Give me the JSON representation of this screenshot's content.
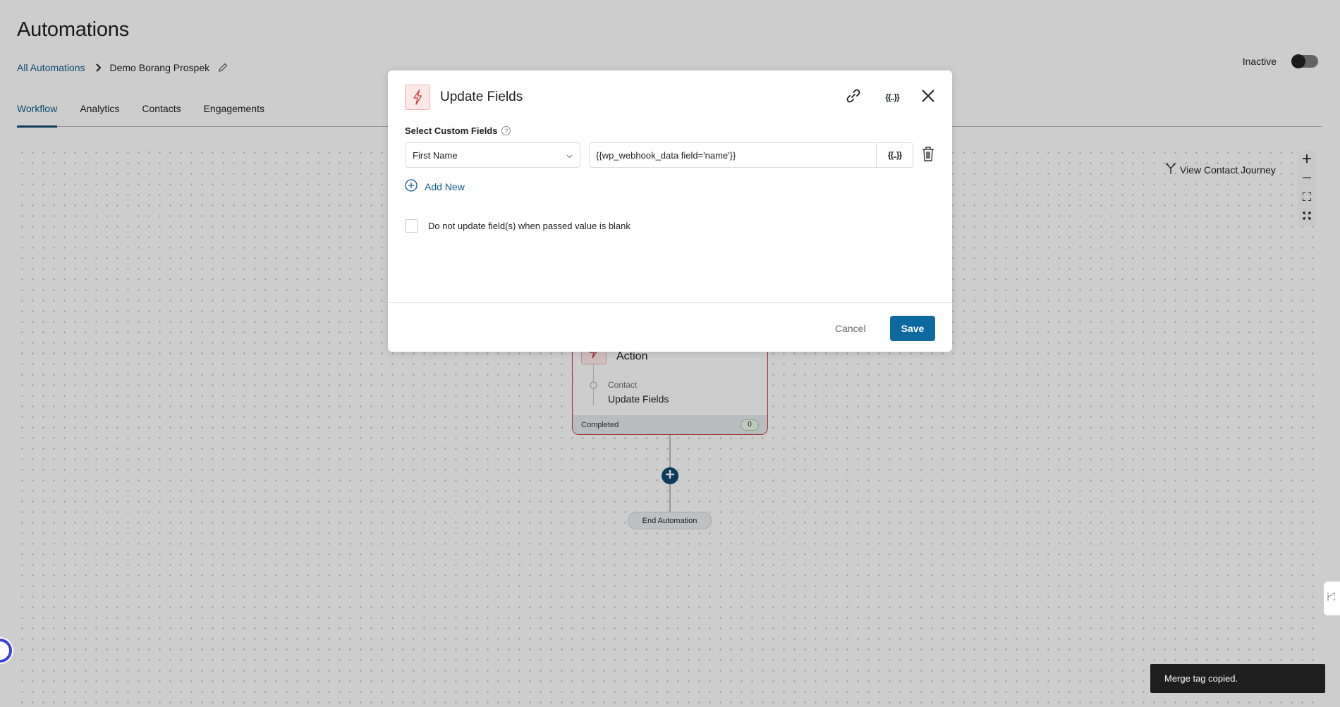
{
  "page": {
    "title": "Automations",
    "breadcrumb": {
      "root": "All Automations",
      "current": "Demo Borang Prospek"
    },
    "tabs": [
      {
        "label": "Workflow",
        "active": true
      },
      {
        "label": "Analytics",
        "active": false
      },
      {
        "label": "Contacts",
        "active": false
      },
      {
        "label": "Engagements",
        "active": false
      }
    ],
    "status": {
      "label": "Inactive",
      "enabled": false
    }
  },
  "canvas": {
    "journey_label": "View Contact Journey",
    "zoom_controls": [
      "zoom-in",
      "zoom-out",
      "fit-view",
      "fullscreen"
    ],
    "node": {
      "title": "Action",
      "category": "Contact",
      "name": "Update Fields",
      "footer_label": "Completed",
      "count": "0"
    },
    "end_label": "End Automation"
  },
  "modal": {
    "title": "Update Fields",
    "field_label": "Select Custom Fields",
    "rows": [
      {
        "field": "First Name",
        "value": "{{wp_webhook_data field='name'}}"
      }
    ],
    "merge_tag_glyph": "{{..}}",
    "add_new_label": "Add New",
    "checkbox_label": "Do not update field(s) when passed value is blank",
    "checkbox_checked": false,
    "cancel_label": "Cancel",
    "save_label": "Save"
  },
  "toast": {
    "message": "Merge tag copied."
  },
  "colors": {
    "primary": "#0d6aa0",
    "link": "#0d5a8a",
    "action_accent": "#c43c3c",
    "toast_bg": "#1e1e1e"
  }
}
